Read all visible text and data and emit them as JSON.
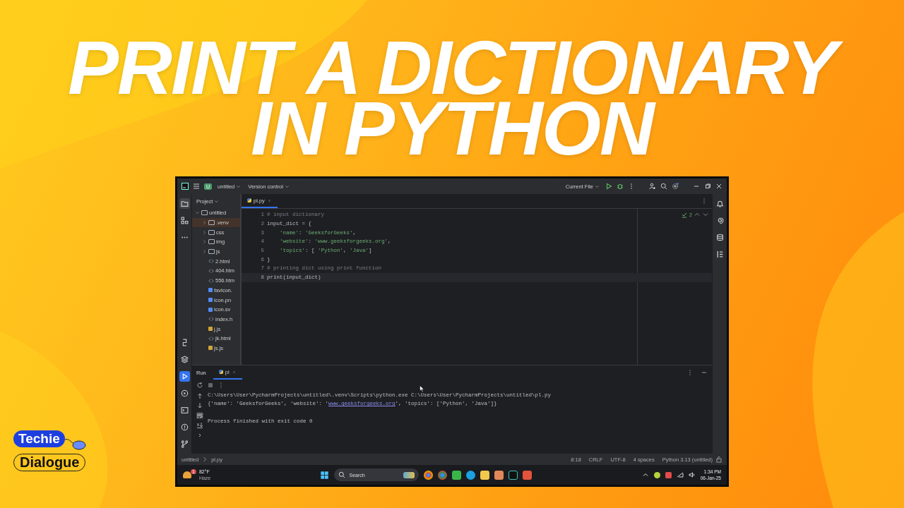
{
  "headline": [
    "PRINT A DICTIONARY",
    "IN PYTHON"
  ],
  "ide": {
    "toolbar": {
      "project_badge": "U",
      "project": "untitled",
      "vcs": "Version control",
      "run_config": "Current File"
    },
    "project_panel": {
      "title": "Project",
      "tree": [
        {
          "name": "untitled",
          "kind": "folder",
          "expanded": true,
          "selected": false,
          "children": [
            {
              "name": ".venv",
              "kind": "folder",
              "expanded": false,
              "selected": true
            },
            {
              "name": "css",
              "kind": "folder",
              "expanded": false,
              "selected": false
            },
            {
              "name": "img",
              "kind": "folder",
              "expanded": false,
              "selected": false
            },
            {
              "name": "js",
              "kind": "folder",
              "expanded": false,
              "selected": false
            },
            {
              "name": "2.html",
              "kind": "html",
              "selected": false
            },
            {
              "name": "404.htm",
              "kind": "html",
              "selected": false
            },
            {
              "name": "556.htm",
              "kind": "html",
              "selected": false
            },
            {
              "name": "favicon.",
              "kind": "image",
              "selected": false
            },
            {
              "name": "icon.pn",
              "kind": "image",
              "selected": false
            },
            {
              "name": "icon.sv",
              "kind": "image",
              "selected": false
            },
            {
              "name": "index.h",
              "kind": "html",
              "selected": false
            },
            {
              "name": "j.js",
              "kind": "js",
              "selected": false
            },
            {
              "name": "jk.html",
              "kind": "html",
              "selected": false
            },
            {
              "name": "js.js",
              "kind": "js",
              "selected": false
            }
          ]
        }
      ]
    },
    "tabs": [
      {
        "label": "pl.py",
        "selected": true
      }
    ],
    "inspection_count": "2",
    "code_lines": [
      {
        "number": "1",
        "current": false,
        "tokens": [
          {
            "kind": "comment",
            "text": "# input dictionary"
          }
        ]
      },
      {
        "number": "2",
        "current": false,
        "tokens": [
          {
            "kind": "text",
            "text": "input_dict = {"
          }
        ]
      },
      {
        "number": "3",
        "current": false,
        "indented": true,
        "tokens": [
          {
            "kind": "string",
            "text": "'name'"
          },
          {
            "kind": "text",
            "text": ": "
          },
          {
            "kind": "string",
            "text": "'GeeksforGeeks'"
          },
          {
            "kind": "text",
            "text": ","
          }
        ]
      },
      {
        "number": "4",
        "current": false,
        "indented": true,
        "tokens": [
          {
            "kind": "string",
            "text": "'website'"
          },
          {
            "kind": "text",
            "text": ": "
          },
          {
            "kind": "string",
            "text": "'www.geeksforgeeks.org'"
          },
          {
            "kind": "text",
            "text": ","
          }
        ]
      },
      {
        "number": "5",
        "current": false,
        "indented": true,
        "tokens": [
          {
            "kind": "string",
            "text": "'topics'"
          },
          {
            "kind": "text",
            "text": ": [ "
          },
          {
            "kind": "string",
            "text": "'Python'"
          },
          {
            "kind": "text",
            "text": ", "
          },
          {
            "kind": "string",
            "text": "'Java'"
          },
          {
            "kind": "text",
            "text": "]"
          }
        ]
      },
      {
        "number": "6",
        "current": false,
        "tokens": [
          {
            "kind": "text",
            "text": "}"
          }
        ]
      },
      {
        "number": "7",
        "current": false,
        "tokens": [
          {
            "kind": "comment",
            "text": "# printing dict using print function"
          }
        ]
      },
      {
        "number": "8",
        "current": true,
        "tokens": [
          {
            "kind": "text",
            "text": "print(input_dict)"
          }
        ]
      }
    ],
    "run_panel": {
      "title": "Run",
      "tabs": [
        {
          "label": "pl",
          "selected": true
        }
      ],
      "output": [
        {
          "kind": "command",
          "tokens": [
            {
              "kind": "text",
              "text": "C:\\Users\\User\\PycharmProjects\\untitled\\.venv\\Scripts\\python.exe C:\\Users\\User\\PycharmProjects\\untitled\\pl.py"
            }
          ]
        },
        {
          "kind": "stdout",
          "tokens": [
            {
              "kind": "text",
              "text": "{'name': 'GeeksforGeeks', 'website': '"
            },
            {
              "kind": "link",
              "text": "www.geeksforgeeks.org"
            },
            {
              "kind": "text",
              "text": "', 'topics': ['Python', 'Java']}"
            }
          ]
        },
        {
          "kind": "status",
          "tokens": [
            {
              "kind": "text",
              "text": "Process finished with exit code 0"
            }
          ]
        }
      ]
    },
    "status_bar": {
      "breadcrumbs": [
        "untitled",
        "pl.py"
      ],
      "items": [
        "8:18",
        "CRLF",
        "UTF-8",
        "4 spaces",
        "Python 3.13 (untitled)"
      ]
    },
    "taskbar": {
      "weather": {
        "badge": "1",
        "temp": "82°F",
        "condition": "Haze"
      },
      "search": "Search",
      "time": "1:34 PM",
      "date": "06-Jan-25"
    }
  },
  "logo": {
    "top": "Techie",
    "bottom": "Dialogue"
  }
}
